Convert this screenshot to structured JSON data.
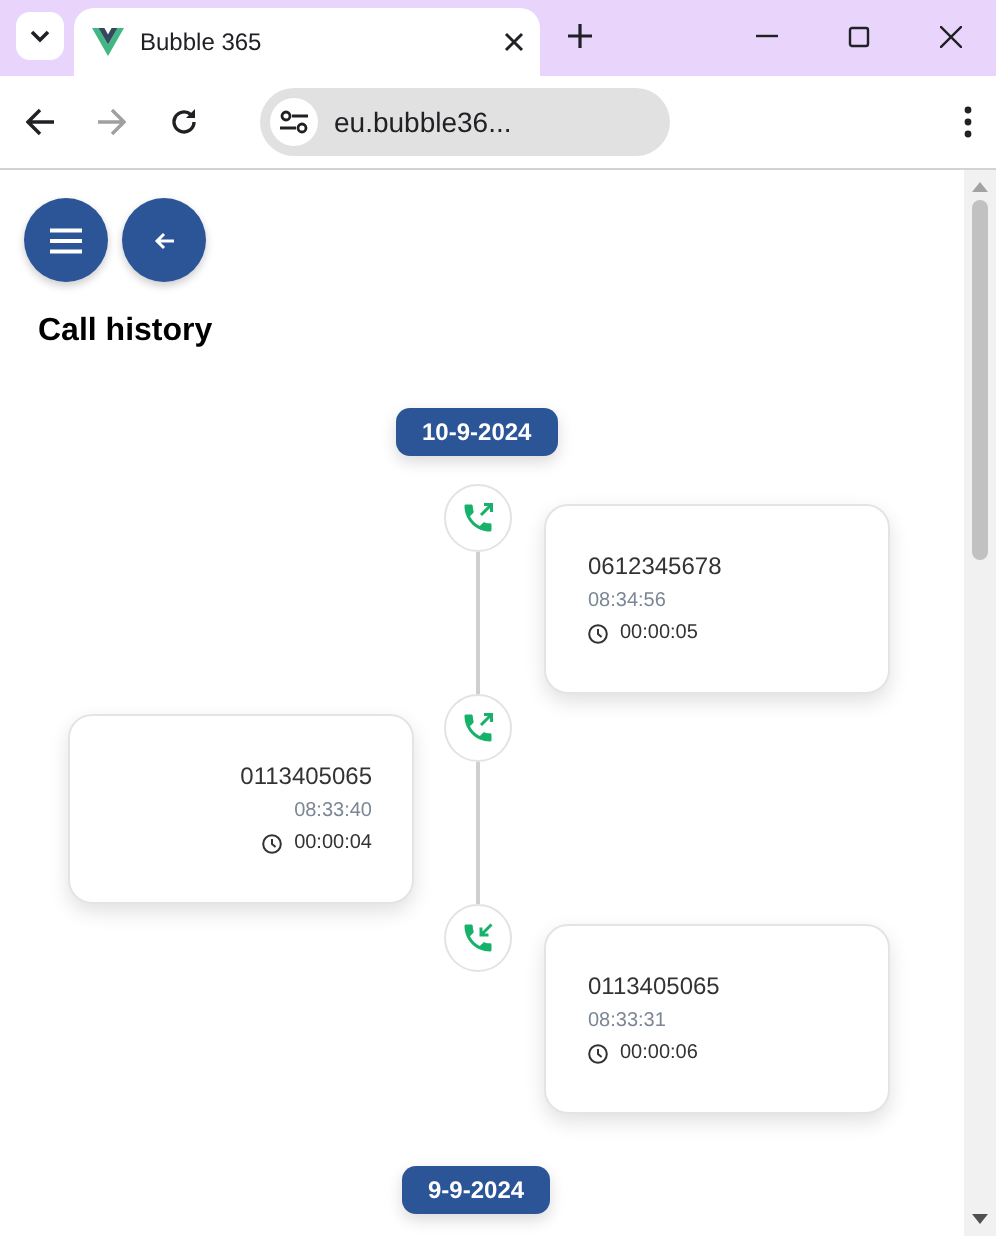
{
  "browser": {
    "tabs": [
      {
        "title": "Bubble 365",
        "selected": true
      }
    ],
    "address": "eu.bubble36..."
  },
  "page": {
    "title": "Call history",
    "groups": [
      {
        "date": "10-9-2024",
        "calls": [
          {
            "kind": "outgoing",
            "number": "0612345678",
            "time": "08:34:56",
            "duration": "00:00:05"
          },
          {
            "kind": "outgoing",
            "number": "0113405065",
            "time": "08:33:40",
            "duration": "00:00:04"
          },
          {
            "kind": "incoming",
            "number": "0113405065",
            "time": "08:33:31",
            "duration": "00:00:06"
          }
        ]
      },
      {
        "date": "9-9-2024"
      }
    ]
  }
}
